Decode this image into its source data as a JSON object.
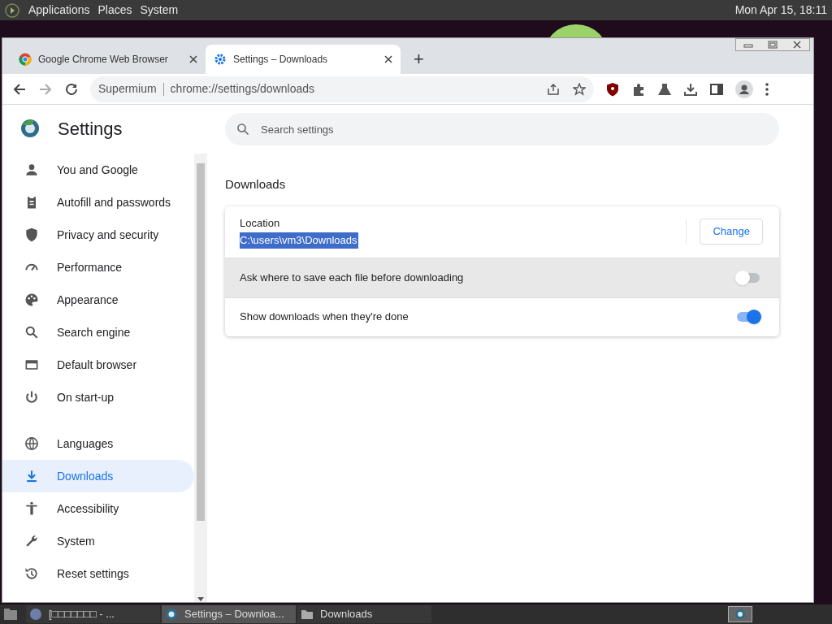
{
  "top_panel": {
    "menus": [
      "Applications",
      "Places",
      "System"
    ],
    "clock": "Mon Apr 15, 18:11"
  },
  "tabs": [
    {
      "title": "Google Chrome Web Browser",
      "selected": false
    },
    {
      "title": "Settings – Downloads",
      "selected": true
    }
  ],
  "new_tab": "+",
  "address_bar": {
    "site": "Supermium",
    "url": "chrome://settings/downloads"
  },
  "settings": {
    "title": "Settings",
    "search_placeholder": "Search settings",
    "sidebar": [
      {
        "label": "You and Google",
        "selected": false
      },
      {
        "label": "Autofill and passwords",
        "selected": false
      },
      {
        "label": "Privacy and security",
        "selected": false
      },
      {
        "label": "Performance",
        "selected": false
      },
      {
        "label": "Appearance",
        "selected": false
      },
      {
        "label": "Search engine",
        "selected": false
      },
      {
        "label": "Default browser",
        "selected": false
      },
      {
        "label": "On start-up",
        "selected": false
      },
      {
        "label": "Languages",
        "selected": false
      },
      {
        "label": "Downloads",
        "selected": true
      },
      {
        "label": "Accessibility",
        "selected": false
      },
      {
        "label": "System",
        "selected": false
      },
      {
        "label": "Reset settings",
        "selected": false
      }
    ],
    "section_title": "Downloads",
    "location": {
      "label": "Location",
      "path": "C:\\users\\vm3\\Downloads",
      "button": "Change"
    },
    "toggles": [
      {
        "label": "Ask where to save each file before downloading",
        "on": false,
        "hovered": true
      },
      {
        "label": "Show downloads when they're done",
        "on": true,
        "hovered": false
      }
    ]
  },
  "taskbar": [
    {
      "label": "[□□□□□□□ - ...",
      "kind": "globe",
      "selected": false
    },
    {
      "label": "Settings – Downloa...",
      "kind": "browser",
      "selected": true
    },
    {
      "label": "Downloads",
      "kind": "folder",
      "selected": false
    }
  ]
}
